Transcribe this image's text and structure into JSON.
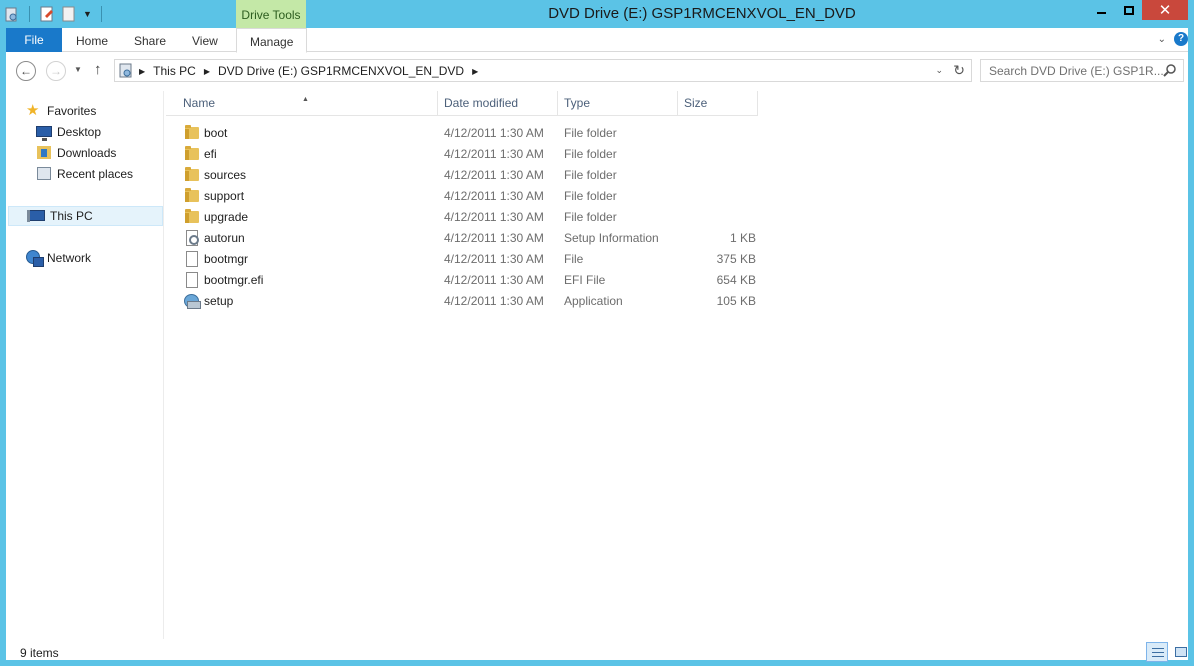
{
  "window": {
    "title": "DVD Drive (E:) GSP1RMCENXVOL_EN_DVD",
    "context_tab": "Drive Tools"
  },
  "ribbon": {
    "tabs": [
      "File",
      "Home",
      "Share",
      "View",
      "Manage"
    ]
  },
  "address": {
    "crumbs": [
      "This PC",
      "DVD Drive (E:) GSP1RMCENXVOL_EN_DVD"
    ],
    "search_placeholder": "Search DVD Drive (E:) GSP1R..."
  },
  "navpane": {
    "favorites": "Favorites",
    "favorites_items": [
      "Desktop",
      "Downloads",
      "Recent places"
    ],
    "this_pc": "This PC",
    "network": "Network"
  },
  "columns": {
    "name": "Name",
    "date": "Date modified",
    "type": "Type",
    "size": "Size"
  },
  "files": [
    {
      "name": "boot",
      "date": "4/12/2011 1:30 AM",
      "type": "File folder",
      "size": "",
      "icon": "folder-icon"
    },
    {
      "name": "efi",
      "date": "4/12/2011 1:30 AM",
      "type": "File folder",
      "size": "",
      "icon": "folder-icon"
    },
    {
      "name": "sources",
      "date": "4/12/2011 1:30 AM",
      "type": "File folder",
      "size": "",
      "icon": "folder-icon"
    },
    {
      "name": "support",
      "date": "4/12/2011 1:30 AM",
      "type": "File folder",
      "size": "",
      "icon": "folder-icon"
    },
    {
      "name": "upgrade",
      "date": "4/12/2011 1:30 AM",
      "type": "File folder",
      "size": "",
      "icon": "folder-icon"
    },
    {
      "name": "autorun",
      "date": "4/12/2011 1:30 AM",
      "type": "Setup Information",
      "size": "1 KB",
      "icon": "setup-info-icon"
    },
    {
      "name": "bootmgr",
      "date": "4/12/2011 1:30 AM",
      "type": "File",
      "size": "375 KB",
      "icon": "file-icon"
    },
    {
      "name": "bootmgr.efi",
      "date": "4/12/2011 1:30 AM",
      "type": "EFI File",
      "size": "654 KB",
      "icon": "file-icon"
    },
    {
      "name": "setup",
      "date": "4/12/2011 1:30 AM",
      "type": "Application",
      "size": "105 KB",
      "icon": "setup-app-icon"
    }
  ],
  "status": {
    "item_count": "9 items"
  },
  "colors": {
    "frame": "#5bc3e6",
    "file_tab": "#1979ca",
    "context_tab": "#c4e8a7",
    "close_button": "#c9483c"
  }
}
